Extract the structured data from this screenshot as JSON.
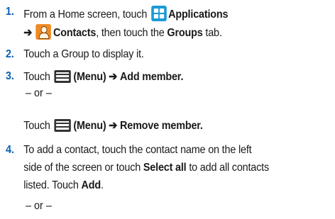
{
  "steps": [
    {
      "number": "1.",
      "line1_pre": "From a Home screen, touch",
      "applications_label": "Applications",
      "arrow": "➔",
      "contacts_label": "Contacts",
      "line2_mid": ", then touch the",
      "groups_label": "Groups",
      "line2_end": "tab."
    },
    {
      "number": "2.",
      "text": "Touch a Group to display it."
    },
    {
      "number": "3.",
      "touch": "Touch",
      "menu_label": "(Menu)",
      "arrow": "➔",
      "add_member": "Add member.",
      "or": "– or –",
      "remove_member": "Remove member."
    },
    {
      "number": "4.",
      "line1": "To add a contact, touch the contact name on the left",
      "line2_pre": "side of the screen or touch",
      "select_all": "Select all",
      "line2_post": "to add all contacts",
      "line3_pre": "listed. Touch",
      "add": "Add",
      "line3_post": ".",
      "or": "– or –"
    }
  ],
  "icons": {
    "applications": "applications-grid-icon",
    "contacts": "contacts-person-icon",
    "menu": "menu-icon"
  },
  "colors": {
    "step_number": "#0a5fb4",
    "applications_icon": "#1b9ad6",
    "contacts_icon": "#f08a24"
  }
}
